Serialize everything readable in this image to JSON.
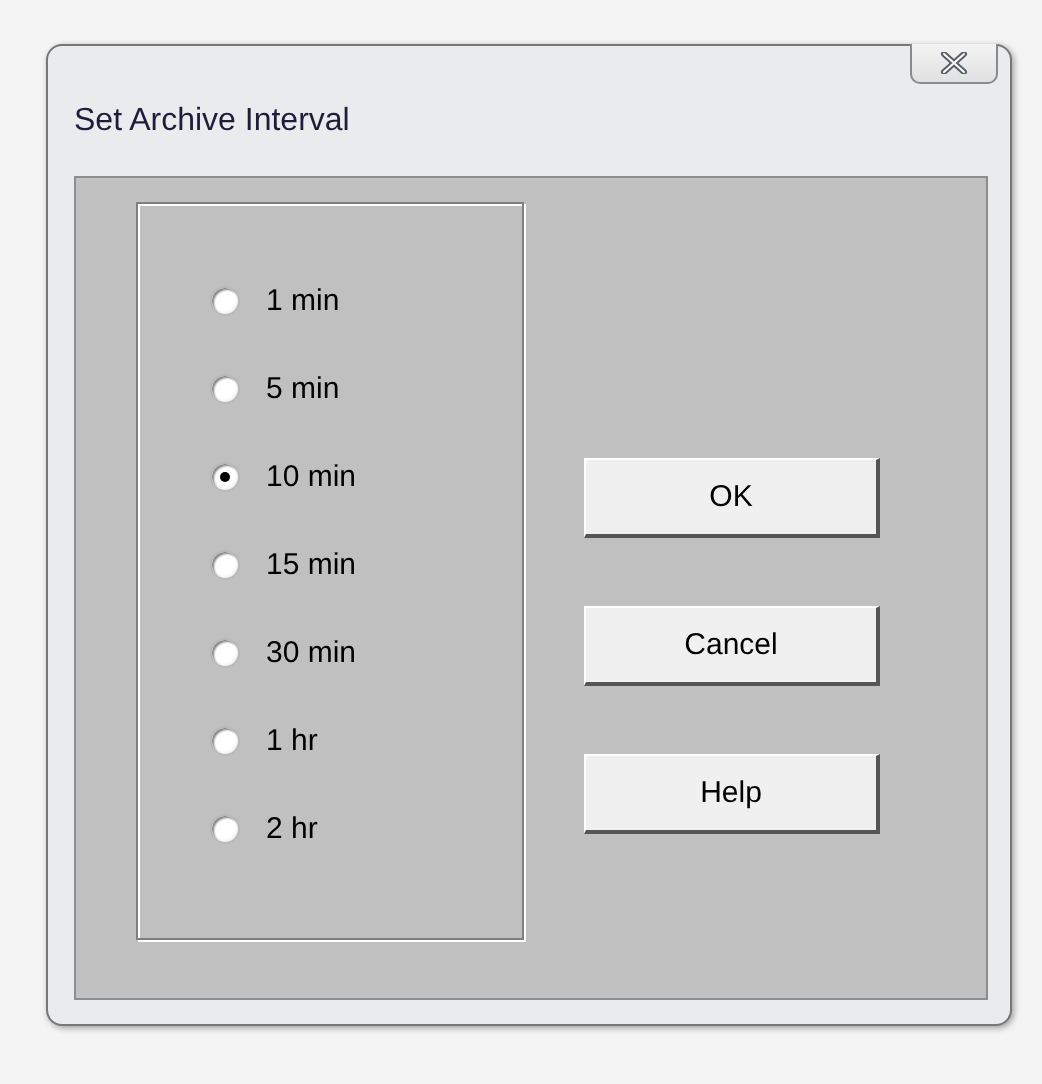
{
  "window": {
    "title": "Set Archive Interval"
  },
  "intervals": [
    {
      "label": "1 min",
      "selected": false
    },
    {
      "label": "5 min",
      "selected": false
    },
    {
      "label": "10 min",
      "selected": true
    },
    {
      "label": "15 min",
      "selected": false
    },
    {
      "label": "30 min",
      "selected": false
    },
    {
      "label": "1 hr",
      "selected": false
    },
    {
      "label": "2 hr",
      "selected": false
    }
  ],
  "buttons": [
    "OK",
    "Cancel",
    "Help"
  ]
}
